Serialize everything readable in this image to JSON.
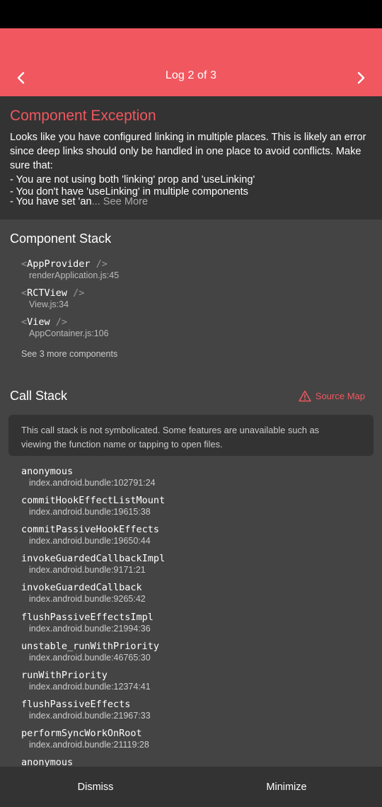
{
  "header": {
    "title": "Log 2 of 3",
    "background": "#f0575f"
  },
  "exception": {
    "title": "Component Exception",
    "lines": [
      "Looks like you have configured linking in multiple places. This is likely an error",
      "since deep links should only be handled in one place to avoid conflicts. Make",
      "sure that:",
      "- You are not using both 'linking' prop and 'useLinking'",
      "- You don't have 'useLinking' in multiple components",
      "- You have set 'an"
    ],
    "see_more": "... See More"
  },
  "component_stack": {
    "title": "Component Stack",
    "frames": [
      {
        "name": "AppProvider",
        "file": "renderApplication.js:45"
      },
      {
        "name": "RCTView",
        "file": "View.js:34"
      },
      {
        "name": "View",
        "file": "AppContainer.js:106"
      }
    ],
    "see_more": "See 3 more components"
  },
  "call_stack": {
    "title": "Call Stack",
    "source_map_label": "Source Map",
    "notice": [
      "This call stack is not symbolicated. Some features are unavailable such as",
      "viewing the function name or tapping to open files."
    ],
    "frames": [
      {
        "name": "anonymous",
        "file": "index.android.bundle:102791:24"
      },
      {
        "name": "commitHookEffectListMount",
        "file": "index.android.bundle:19615:38"
      },
      {
        "name": "commitPassiveHookEffects",
        "file": "index.android.bundle:19650:44"
      },
      {
        "name": "invokeGuardedCallbackImpl",
        "file": "index.android.bundle:9171:21"
      },
      {
        "name": "invokeGuardedCallback",
        "file": "index.android.bundle:9265:42"
      },
      {
        "name": "flushPassiveEffectsImpl",
        "file": "index.android.bundle:21994:36"
      },
      {
        "name": "unstable_runWithPriority",
        "file": "index.android.bundle:46765:30"
      },
      {
        "name": "runWithPriority",
        "file": "index.android.bundle:12374:41"
      },
      {
        "name": "flushPassiveEffects",
        "file": "index.android.bundle:21967:33"
      },
      {
        "name": "performSyncWorkOnRoot",
        "file": "index.android.bundle:21119:28"
      },
      {
        "name": "anonymous",
        "file": ""
      }
    ]
  },
  "footer": {
    "dismiss": "Dismiss",
    "minimize": "Minimize"
  },
  "colors": {
    "accent": "#f0575f",
    "panel_dark": "#333333",
    "panel": "#444444"
  },
  "icons": {
    "prev": "chevron-left-icon",
    "next": "chevron-right-icon",
    "source_map": "warning-triangle-icon"
  }
}
